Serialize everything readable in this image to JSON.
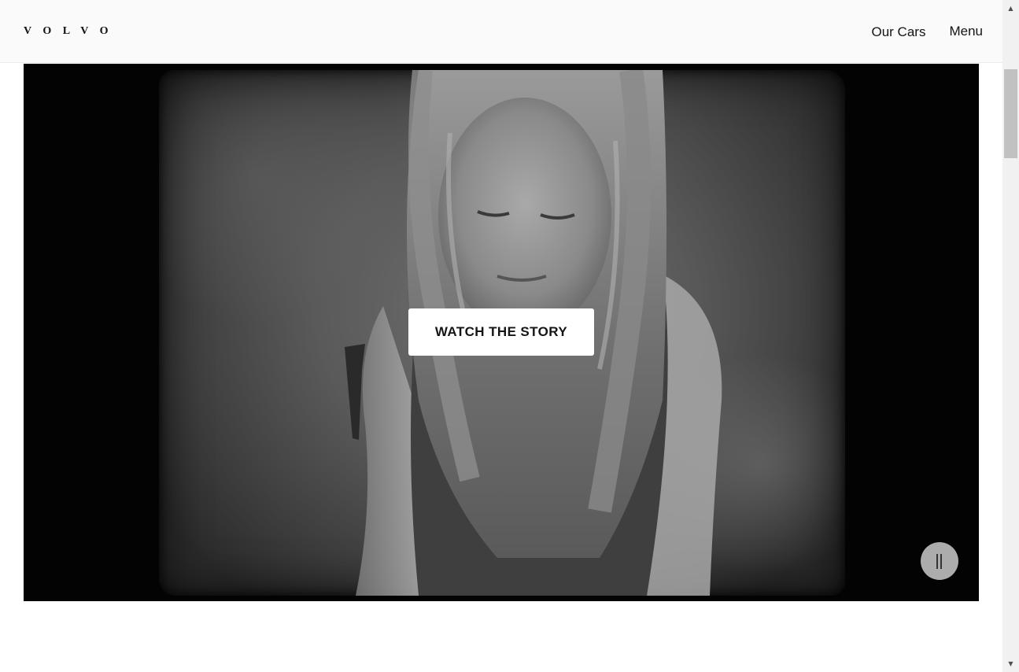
{
  "header": {
    "logo_text": "VOLVO",
    "nav": {
      "our_cars": "Our Cars",
      "menu": "Menu"
    }
  },
  "hero_video": {
    "cta_label": "WATCH THE STORY",
    "pause_icon": "pause-icon",
    "state": "playing"
  },
  "scrollbar": {
    "up_icon": "triangle-up-icon",
    "down_icon": "triangle-down-icon"
  },
  "colors": {
    "header_bg": "#fafafa",
    "video_bg": "#030303",
    "cta_bg": "#ffffff",
    "text": "#141414"
  }
}
